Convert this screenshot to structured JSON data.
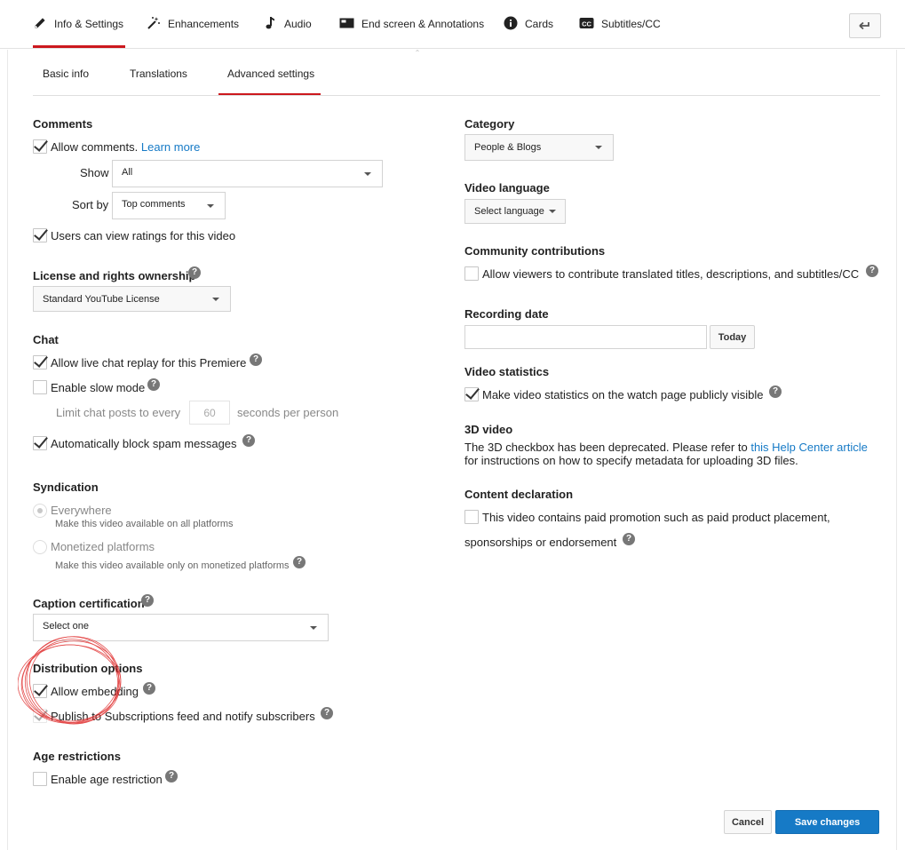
{
  "top_tabs": [
    {
      "label": "Info & Settings",
      "icon": "pencil-icon",
      "active": true
    },
    {
      "label": "Enhancements",
      "icon": "magic-wand-icon"
    },
    {
      "label": "Audio",
      "icon": "music-note-icon"
    },
    {
      "label": "End screen & Annotations",
      "icon": "end-screen-icon"
    },
    {
      "label": "Cards",
      "icon": "info-circle-icon"
    },
    {
      "label": "Subtitles/CC",
      "icon": "cc-icon"
    }
  ],
  "back_button_icon": "back-arrow-icon",
  "sub_tabs": [
    {
      "label": "Basic info"
    },
    {
      "label": "Translations"
    },
    {
      "label": "Advanced settings",
      "active": true
    }
  ],
  "comments": {
    "heading": "Comments",
    "allow_label": "Allow comments.",
    "learn_more": "Learn more",
    "allow_checked": true,
    "show_label": "Show",
    "show_value": "All",
    "sort_label": "Sort by",
    "sort_value": "Top comments",
    "ratings_label": "Users can view ratings for this video",
    "ratings_checked": true
  },
  "license": {
    "heading": "License and rights ownership",
    "value": "Standard YouTube License"
  },
  "chat": {
    "heading": "Chat",
    "replay_label": "Allow live chat replay for this Premiere",
    "replay_checked": true,
    "slow_mode_label": "Enable slow mode",
    "slow_mode_checked": false,
    "limit_prefix": "Limit chat posts to every",
    "limit_value": "60",
    "limit_suffix": "seconds per person",
    "spam_label": "Automatically block spam messages",
    "spam_checked": true
  },
  "syndication": {
    "heading": "Syndication",
    "everywhere_label": "Everywhere",
    "everywhere_sub": "Make this video available on all platforms",
    "monetized_label": "Monetized platforms",
    "monetized_sub": "Make this video available only on monetized platforms",
    "selected": "everywhere"
  },
  "caption": {
    "heading": "Caption certification",
    "value": "Select one"
  },
  "distribution": {
    "heading": "Distribution options",
    "embed_label": "Allow embedding",
    "embed_checked": true,
    "publish_label": "Publish to Subscriptions feed and notify subscribers",
    "publish_checked": true
  },
  "age": {
    "heading": "Age restrictions",
    "label": "Enable age restriction",
    "checked": false
  },
  "category": {
    "heading": "Category",
    "value": "People & Blogs"
  },
  "video_language": {
    "heading": "Video language",
    "value": "Select language"
  },
  "community": {
    "heading": "Community contributions",
    "label": "Allow viewers to contribute translated titles, descriptions, and subtitles/CC",
    "checked": false
  },
  "recording": {
    "heading": "Recording date",
    "value": "",
    "today_label": "Today"
  },
  "statistics": {
    "heading": "Video statistics",
    "label": "Make video statistics on the watch page publicly visible",
    "checked": true
  },
  "video3d": {
    "heading": "3D video",
    "text_before": "The 3D checkbox has been deprecated. Please refer to",
    "link": "this Help Center article",
    "text_after": "for instructions on how to specify metadata for uploading 3D files."
  },
  "content_declaration": {
    "heading": "Content declaration",
    "line1": "This video contains paid promotion such as paid product placement,",
    "line2": "sponsorships or endorsement",
    "checked": false
  },
  "help_glyph": "?",
  "collapse_glyph": "⌃",
  "actions": {
    "cancel": "Cancel",
    "save": "Save changes"
  },
  "colors": {
    "accent_red": "#cc181e",
    "primary_blue": "#167ac6",
    "annotation_red": "#e03030"
  }
}
